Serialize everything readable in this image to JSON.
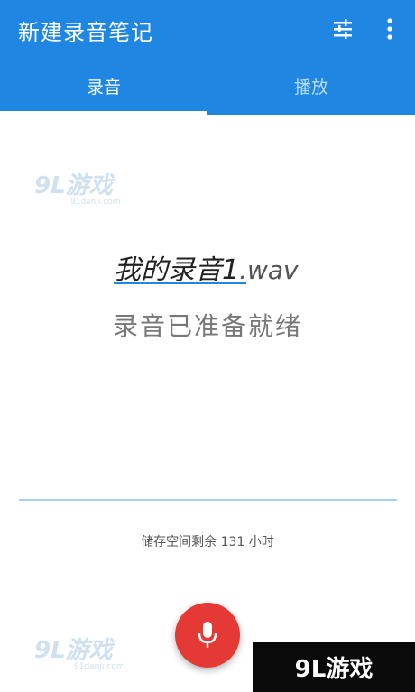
{
  "app": {
    "title": "新建录音笔记"
  },
  "toolbar": {
    "icons": [
      "tune-icon",
      "more-vert-icon"
    ]
  },
  "tabs": [
    {
      "label": "录音",
      "active": true
    },
    {
      "label": "播放",
      "active": false
    }
  ],
  "recording": {
    "filename_base": "我的录音1",
    "filename_ext": ".wav",
    "status": "录音已准备就绪"
  },
  "storage": {
    "text": "储存空间剩余 131 小时"
  },
  "watermark": {
    "logo_text": "9L游戏",
    "site_text": "91danji.com"
  },
  "colors": {
    "primary": "#1f87e1",
    "accent": "#e53935",
    "divider": "#a6d0f2"
  }
}
